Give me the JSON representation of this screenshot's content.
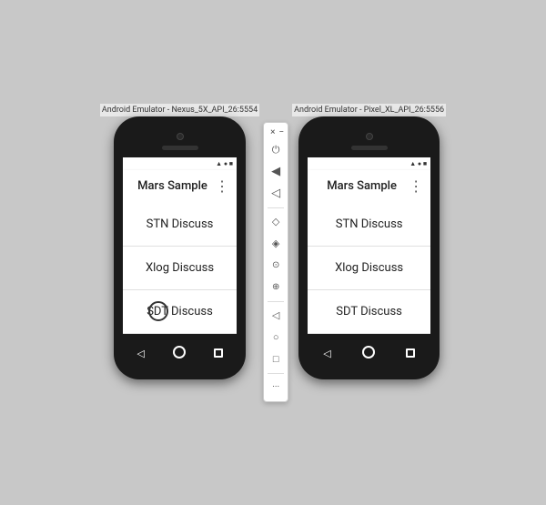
{
  "leftEmulator": {
    "titleBar": "Android Emulator - Nexus_5X_API_26:5554",
    "appBar": {
      "title": "Mars Sample",
      "moreIcon": "⋮"
    },
    "listItems": [
      {
        "label": "STN Discuss"
      },
      {
        "label": "Xlog Discuss"
      },
      {
        "label": "SDT Discuss"
      }
    ],
    "navBar": {
      "back": "◁",
      "home": "",
      "recent": "□"
    }
  },
  "rightEmulator": {
    "titleBar": "Android Emulator - Pixel_XL_API_26:5556",
    "appBar": {
      "title": "Mars Sample",
      "moreIcon": "⋮"
    },
    "listItems": [
      {
        "label": "STN Discuss"
      },
      {
        "label": "Xlog Discuss"
      },
      {
        "label": "SDT Discuss"
      }
    ],
    "navBar": {
      "back": "◁",
      "home": "",
      "recent": "□"
    }
  },
  "toolbar": {
    "closeLabel": "×",
    "minLabel": "−",
    "buttons": [
      {
        "icon": "⏻",
        "name": "power"
      },
      {
        "icon": "🔊",
        "name": "volume-up"
      },
      {
        "icon": "🔉",
        "name": "volume-down"
      },
      {
        "icon": "◇",
        "name": "rotate"
      },
      {
        "icon": "◈",
        "name": "fold"
      },
      {
        "icon": "📷",
        "name": "screenshot"
      },
      {
        "icon": "🔍",
        "name": "zoom"
      },
      {
        "icon": "◁",
        "name": "back"
      },
      {
        "icon": "○",
        "name": "home"
      },
      {
        "icon": "□",
        "name": "overview"
      },
      {
        "icon": "···",
        "name": "more"
      }
    ]
  },
  "colors": {
    "background": "#c8c8c8",
    "phoneShell": "#1a1a1a",
    "appBar": "#ffffff",
    "listBg": "#ffffff",
    "divider": "#e0e0e0",
    "navBar": "#1a1a1a",
    "toolbarBg": "#ffffff"
  }
}
